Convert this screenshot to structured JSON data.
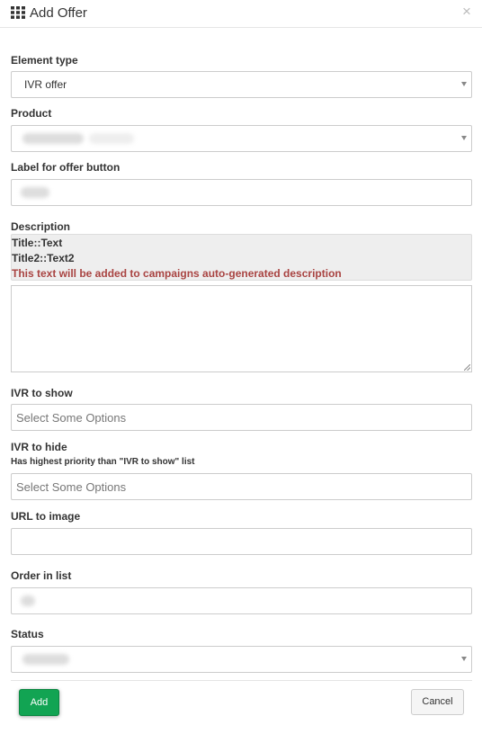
{
  "header": {
    "icon": "grid-icon",
    "title": "Add Offer",
    "close_label": "×"
  },
  "form": {
    "element_type": {
      "label": "Element type",
      "value": "IVR offer"
    },
    "product": {
      "label": "Product"
    },
    "offer_button_label": {
      "label": "Label for offer button"
    },
    "description": {
      "label": "Description",
      "help_line1": "Title::Text",
      "help_line2": "Title2::Text2",
      "help_warning": "This text will be added to campaigns auto-generated description"
    },
    "ivr_show": {
      "label": "IVR to show",
      "placeholder": "Select Some Options"
    },
    "ivr_hide": {
      "label": "IVR to hide",
      "hint": "Has highest priority than \"IVR to show\" list",
      "placeholder": "Select Some Options"
    },
    "url_image": {
      "label": "URL to image"
    },
    "order": {
      "label": "Order in list"
    },
    "status": {
      "label": "Status"
    }
  },
  "footer": {
    "add_label": "Add",
    "cancel_label": "Cancel"
  },
  "colors": {
    "accent_green": "#12a453",
    "warning_text": "#a94442"
  }
}
